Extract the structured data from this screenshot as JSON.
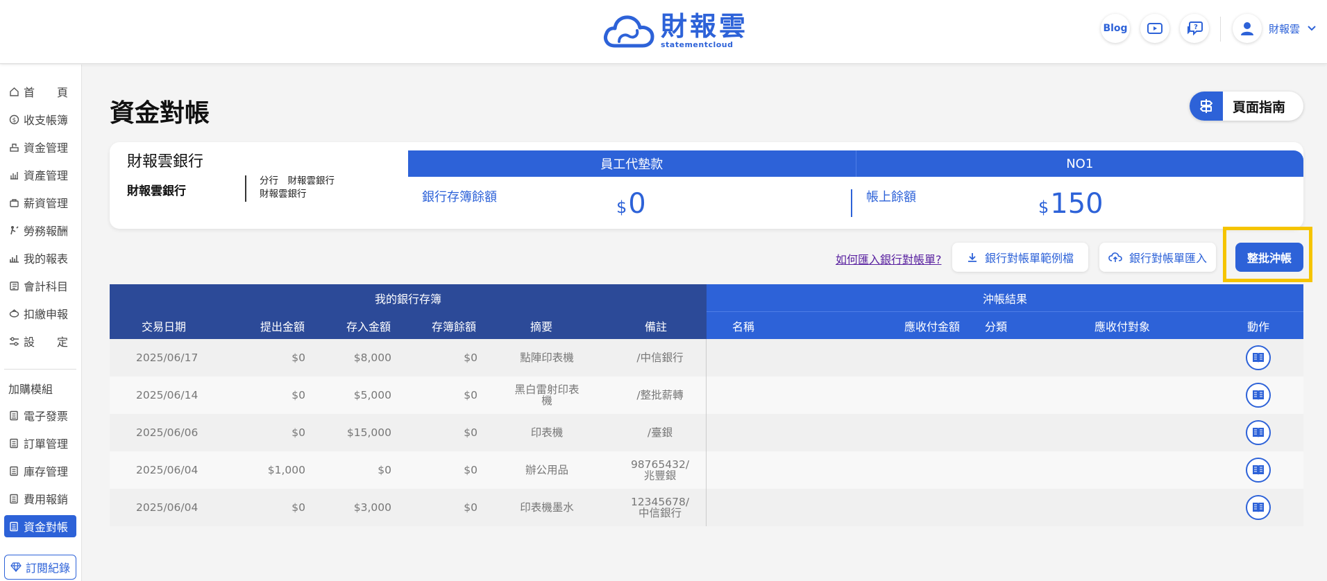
{
  "header": {
    "logo_cn": "財報雲",
    "logo_en": "statementcloud",
    "blog_label": "Blog",
    "user_name": "財報雲"
  },
  "sidebar": {
    "items": [
      {
        "label": "首　　頁",
        "icon": "home-icon"
      },
      {
        "label": "收支帳簿",
        "icon": "coin-icon"
      },
      {
        "label": "資金管理",
        "icon": "funds-icon"
      },
      {
        "label": "資產管理",
        "icon": "assets-icon"
      },
      {
        "label": "薪資管理",
        "icon": "salary-icon"
      },
      {
        "label": "勞務報酬",
        "icon": "labor-icon"
      },
      {
        "label": "我的報表",
        "icon": "report-icon"
      },
      {
        "label": "會計科目",
        "icon": "ledger-icon"
      },
      {
        "label": "扣繳申報",
        "icon": "withholding-icon"
      },
      {
        "label": "設　　定",
        "icon": "settings-icon"
      }
    ],
    "addon_section": "加購模組",
    "addon_items": [
      {
        "label": "電子發票",
        "icon": "invoice-icon"
      },
      {
        "label": "訂單管理",
        "icon": "order-icon"
      },
      {
        "label": "庫存管理",
        "icon": "inventory-icon"
      },
      {
        "label": "費用報銷",
        "icon": "expense-icon"
      },
      {
        "label": "資金對帳",
        "icon": "reconcile-icon"
      }
    ],
    "subscription_label": "訂閱紀錄"
  },
  "page": {
    "title": "資金對帳",
    "guide_label": "頁面指南"
  },
  "summary": {
    "bank_name": "財報雲銀行",
    "bank_sub": "財報雲銀行",
    "branch_line1": "分行　財報雲銀行",
    "branch_line2": "財報雲銀行",
    "col1_header": "員工代墊款",
    "col2_header": "NO1",
    "book_balance_label": "銀行存簿餘額",
    "book_balance_currency": "$",
    "book_balance_value": "0",
    "account_balance_label": "帳上餘額",
    "account_balance_currency": "$",
    "account_balance_value": "150"
  },
  "actions": {
    "import_help_link": "如何匯入銀行對帳單?",
    "template_download": "銀行對帳單範例檔",
    "statement_import": "銀行對帳單匯入",
    "batch_writeoff": "整批沖帳"
  },
  "table": {
    "group_left": "我的銀行存簿",
    "group_right": "沖帳結果",
    "columns": [
      "交易日期",
      "提出金額",
      "存入金額",
      "存簿餘額",
      "摘要",
      "備註",
      "名稱",
      "應收付金額",
      "分類",
      "應收付對象",
      "動作"
    ],
    "rows": [
      {
        "date": "2025/06/17",
        "withdraw": "$0",
        "deposit": "$8,000",
        "balance": "$0",
        "summary_l1": "點陣印表機",
        "summary_l2": "",
        "note_l1": "/中信銀行",
        "note_l2": ""
      },
      {
        "date": "2025/06/14",
        "withdraw": "$0",
        "deposit": "$5,000",
        "balance": "$0",
        "summary_l1": "黑白雷射印表",
        "summary_l2": "機",
        "note_l1": "/整批薪轉",
        "note_l2": ""
      },
      {
        "date": "2025/06/06",
        "withdraw": "$0",
        "deposit": "$15,000",
        "balance": "$0",
        "summary_l1": "印表機",
        "summary_l2": "",
        "note_l1": "/臺銀",
        "note_l2": ""
      },
      {
        "date": "2025/06/04",
        "withdraw": "$1,000",
        "deposit": "$0",
        "balance": "$0",
        "summary_l1": "辦公用品",
        "summary_l2": "",
        "note_l1": "98765432/",
        "note_l2": "兆豐銀"
      },
      {
        "date": "2025/06/04",
        "withdraw": "$0",
        "deposit": "$3,000",
        "balance": "$0",
        "summary_l1": "印表機墨水",
        "summary_l2": "",
        "note_l1": "12345678/",
        "note_l2": "中信銀行"
      }
    ]
  },
  "colors": {
    "accent": "#2d62d8",
    "table_dark": "#2c4a98",
    "highlight": "#f5c400"
  }
}
